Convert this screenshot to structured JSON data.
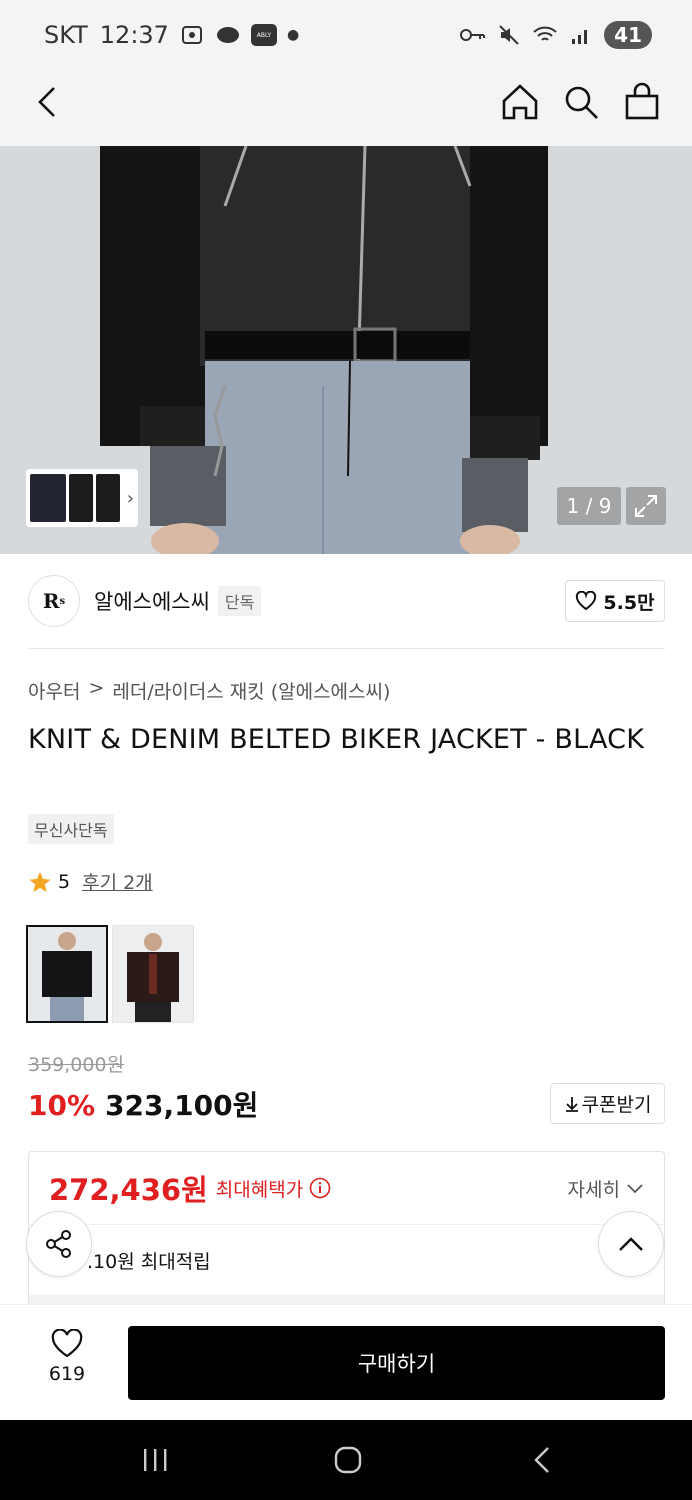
{
  "status_bar": {
    "carrier": "SKT",
    "time": "12:37",
    "ably_label": "ABLY",
    "battery": "41"
  },
  "header": {
    "icons": [
      "back-icon",
      "home-icon",
      "search-icon",
      "bag-icon"
    ]
  },
  "gallery": {
    "pager": "1 / 9"
  },
  "brand": {
    "name": "알에스에스씨",
    "badge": "단독",
    "likes": "5.5만"
  },
  "breadcrumb": {
    "category": "아우터",
    "separator": ">",
    "subcategory": "레더/라이더스 재킷 (알에스에스씨)"
  },
  "product": {
    "title": "KNIT & DENIM BELTED BIKER JACKET - BLACK",
    "exclusive_badge": "무신사단독",
    "rating": "5",
    "reviews": "후기 2개"
  },
  "price": {
    "original": "359,000원",
    "discount": "10%",
    "current": "323,100원",
    "coupon_label": "쿠폰받기"
  },
  "benefit": {
    "max_price": "272,436원",
    "max_label": "최대혜택가",
    "detail_label": "자세히",
    "points": ".10원 최대적립"
  },
  "bottom": {
    "wish_count": "619",
    "buy_label": "구매하기"
  },
  "colors": {
    "sale_red": "#e02020",
    "buy_black": "#000000"
  }
}
